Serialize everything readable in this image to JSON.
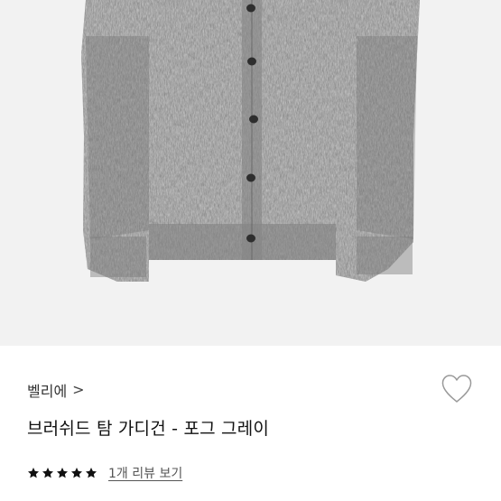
{
  "product": {
    "image_alt_icon": "cardigan-photo",
    "brand": "벨리에",
    "brand_chevron": ">",
    "title": "브러쉬드 탐 가디건 - 포그 그레이",
    "rating": 5,
    "review_link": "1개 리뷰 보기"
  },
  "colors": {
    "image_bg": "#f2f2f2",
    "knit": "#8a8a8a",
    "star": "#111111",
    "heart_stroke": "#999999"
  }
}
